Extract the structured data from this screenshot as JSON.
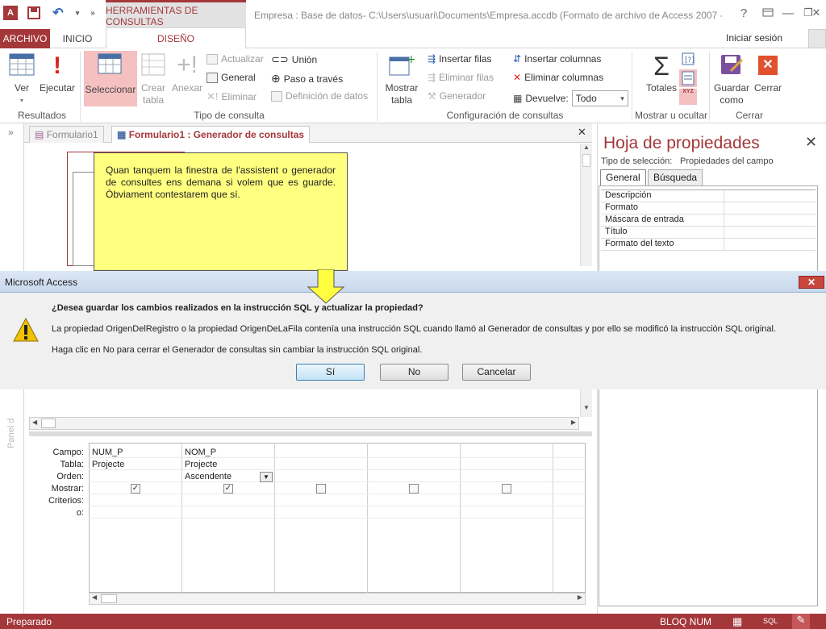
{
  "app": {
    "context_tab": "HERRAMIENTAS DE CONSULTAS",
    "window_title": "Empresa : Base de datos- C:\\Users\\usuari\\Documents\\Empresa.accdb (Formato de archivo de Access 2007 -...",
    "help": "?",
    "minimize": "—",
    "restore": "❐",
    "close": "✕",
    "sign_in": "Iniciar sesión",
    "accent_color": "#a4373a"
  },
  "tabs": {
    "archivo": "ARCHIVO",
    "inicio": "INICIO",
    "diseno": "DISEÑO"
  },
  "ribbon": {
    "ver": "Ver",
    "ejecutar": "Ejecutar",
    "seleccionar": "Seleccionar",
    "crear_tabla_1": "Crear",
    "crear_tabla_2": "tabla",
    "anexar": "Anexar",
    "actualizar": "Actualizar",
    "general": "General",
    "eliminar": "Eliminar",
    "union": "Unión",
    "paso_a_traves": "Paso a través",
    "definicion_datos": "Definición de datos",
    "mostrar_tabla_1": "Mostrar",
    "mostrar_tabla_2": "tabla",
    "insertar_filas": "Insertar filas",
    "eliminar_filas": "Eliminar filas",
    "generador": "Generador",
    "insertar_columnas": "Insertar columnas",
    "eliminar_columnas": "Eliminar columnas",
    "devuelve": "Devuelve:",
    "devuelve_value": "Todo",
    "totales": "Totales",
    "guardar_como_1": "Guardar",
    "guardar_como_2": "como",
    "cerrar": "Cerrar",
    "groups": {
      "resultados": "Resultados",
      "tipo_consulta": "Tipo de consulta",
      "config_consultas": "Configuración de consultas",
      "mostrar_ocultar": "Mostrar u ocultar",
      "cerrar": "Cerrar"
    }
  },
  "doc_tabs": {
    "tab1": "Formulario1",
    "tab2": "Formulario1 : Generador de consultas",
    "close": "✕"
  },
  "properties": {
    "title": "Hoja de propiedades",
    "selection_type_label": "Tipo de selección:",
    "selection_type_value": "Propiedades del campo",
    "tab_general": "General",
    "tab_busqueda": "Búsqueda",
    "rows": [
      "Descripción",
      "Formato",
      "Máscara de entrada",
      "Título",
      "Formato del texto"
    ]
  },
  "callout": {
    "text": "Quan tanquem la finestra de l'assistent o generador de consultes ens demana si volem que es guarde. Òbviament contestarem que sí."
  },
  "dialog": {
    "title": "Microsoft Access",
    "question": "¿Desea guardar los cambios realizados en la instrucción SQL y actualizar la propiedad?",
    "line1": "La propiedad OrigenDelRegistro o la propiedad OrigenDeLaFila contenía una instrucción SQL cuando llamó al Generador de consultas y por ello se modificó la instrucción SQL original.",
    "line2": "Haga clic en No para cerrar el Generador de consultas sin cambiar la instrucción SQL original.",
    "btn_si": "Sí",
    "btn_no": "No",
    "btn_cancelar": "Cancelar"
  },
  "panel_label": "Panel d",
  "qbe": {
    "row_labels": [
      "Campo:",
      "Tabla:",
      "Orden:",
      "Mostrar:",
      "Criterios:",
      "o:"
    ],
    "columns": [
      {
        "campo": "NUM_P",
        "tabla": "Projecte",
        "orden": "",
        "mostrar": true
      },
      {
        "campo": "NOM_P",
        "tabla": "Projecte",
        "orden": "Ascendente",
        "mostrar": true
      },
      {
        "campo": "",
        "tabla": "",
        "orden": "",
        "mostrar": false
      },
      {
        "campo": "",
        "tabla": "",
        "orden": "",
        "mostrar": false
      },
      {
        "campo": "",
        "tabla": "",
        "orden": "",
        "mostrar": false
      }
    ]
  },
  "status": {
    "left": "Preparado",
    "bloq_num": "BLOQ NUM",
    "sql": "SQL"
  }
}
